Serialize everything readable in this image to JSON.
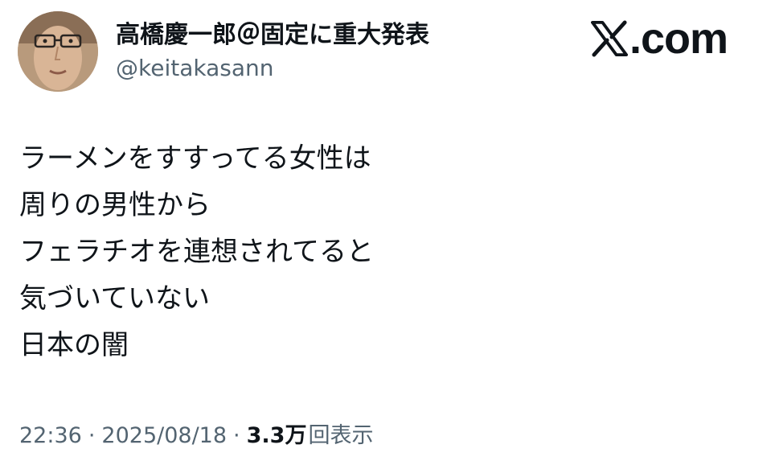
{
  "author": {
    "display_name": "高橋慶一郎＠固定に重大発表",
    "handle": "@keitakasann"
  },
  "brand": {
    "domain": ".com",
    "logo_icon": "x-logo-icon"
  },
  "tweet": {
    "lines": [
      "ラーメンをすすってる女性は",
      "周りの男性から",
      "フェラチオを連想されてると",
      "気づいていない",
      "日本の闇"
    ]
  },
  "meta": {
    "time": "22:36",
    "date": "2025/08/18",
    "separator": "·",
    "views_count": "3.3万",
    "views_label": "回表示"
  },
  "colors": {
    "text_primary": "#0f1419",
    "text_secondary": "#536471",
    "background": "#ffffff"
  }
}
